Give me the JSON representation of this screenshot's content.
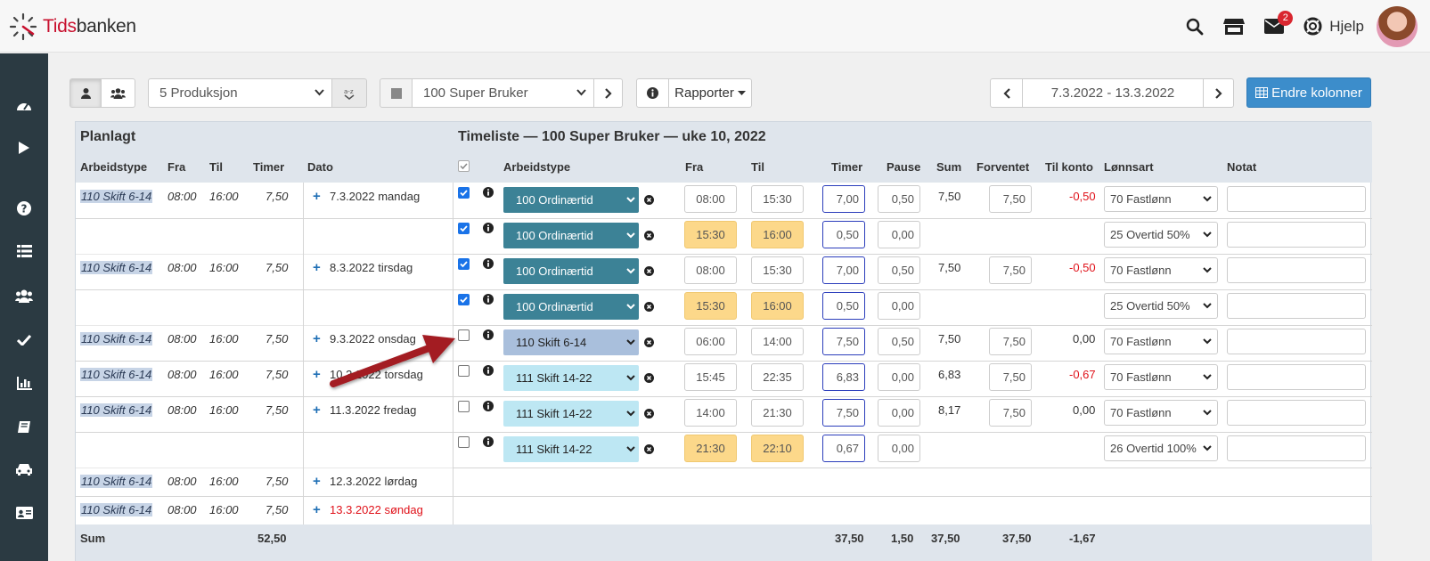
{
  "header": {
    "logo_red": "Tids",
    "logo_dark": "banken",
    "help_label": "Hjelp",
    "mail_badge": "2"
  },
  "sidebar_icons": [
    "dashboard-icon",
    "play-icon",
    "question-icon",
    "list-icon",
    "users-icon",
    "check-icon",
    "chart-icon",
    "book-icon",
    "car-icon",
    "id-card-icon"
  ],
  "toolbar": {
    "department": "5 Produksjon",
    "employee": "100 Super Bruker",
    "reports": "Rapporter",
    "date_range": "7.3.2022 - 13.3.2022",
    "change_columns": "Endre kolonner"
  },
  "table": {
    "left_title": "Planlagt",
    "right_title": "Timeliste — 100 Super Bruker — uke 10, 2022",
    "left_headers": {
      "arbeidstype": "Arbeidstype",
      "fra": "Fra",
      "til": "Til",
      "timer": "Timer",
      "dato": "Dato"
    },
    "right_headers": {
      "arbeidstype": "Arbeidstype",
      "fra": "Fra",
      "til": "Til",
      "timer": "Timer",
      "pause": "Pause",
      "sum": "Sum",
      "forventet": "Forventet",
      "til_konto": "Til konto",
      "lonnsart": "Lønnsart",
      "notat": "Notat"
    },
    "planned": [
      {
        "type": "110 Skift 6-14",
        "fra": "08:00",
        "til": "16:00",
        "timer": "7,50",
        "dato": "7.3.2022 mandag"
      },
      {
        "type": "110 Skift 6-14",
        "fra": "08:00",
        "til": "16:00",
        "timer": "7,50",
        "dato": "8.3.2022 tirsdag"
      },
      {
        "type": "110 Skift 6-14",
        "fra": "08:00",
        "til": "16:00",
        "timer": "7,50",
        "dato": "9.3.2022 onsdag"
      },
      {
        "type": "110 Skift 6-14",
        "fra": "08:00",
        "til": "16:00",
        "timer": "7,50",
        "dato": "10.3.2022 torsdag"
      },
      {
        "type": "110 Skift 6-14",
        "fra": "08:00",
        "til": "16:00",
        "timer": "7,50",
        "dato": "11.3.2022 fredag"
      },
      {
        "type": "110 Skift 6-14",
        "fra": "08:00",
        "til": "16:00",
        "timer": "7,50",
        "dato": "12.3.2022 lørdag"
      },
      {
        "type": "110 Skift 6-14",
        "fra": "08:00",
        "til": "16:00",
        "timer": "7,50",
        "dato": "13.3.2022 søndag"
      }
    ],
    "entries": [
      {
        "checked": true,
        "type": "100 Ordinærtid",
        "style": "dark",
        "fra": "08:00",
        "til": "15:30",
        "yellow": false,
        "timer": "7,00",
        "pause": "0,50",
        "sum": "7,50",
        "forventet": "7,50",
        "til_konto": "-0,50",
        "konto_red": true,
        "lonnsart": "70 Fastlønn"
      },
      {
        "checked": true,
        "type": "100 Ordinærtid",
        "style": "dark",
        "fra": "15:30",
        "til": "16:00",
        "yellow": true,
        "timer": "0,50",
        "pause": "0,00",
        "sum": "",
        "forventet": "",
        "til_konto": "",
        "konto_red": false,
        "lonnsart": "25 Overtid 50%"
      },
      {
        "checked": true,
        "type": "100 Ordinærtid",
        "style": "dark",
        "fra": "08:00",
        "til": "15:30",
        "yellow": false,
        "timer": "7,00",
        "pause": "0,50",
        "sum": "7,50",
        "forventet": "7,50",
        "til_konto": "-0,50",
        "konto_red": true,
        "lonnsart": "70 Fastlønn"
      },
      {
        "checked": true,
        "type": "100 Ordinærtid",
        "style": "dark",
        "fra": "15:30",
        "til": "16:00",
        "yellow": true,
        "timer": "0,50",
        "pause": "0,00",
        "sum": "",
        "forventet": "",
        "til_konto": "",
        "konto_red": false,
        "lonnsart": "25 Overtid 50%"
      },
      {
        "checked": false,
        "type": "110 Skift 6-14",
        "style": "grey",
        "fra": "06:00",
        "til": "14:00",
        "yellow": false,
        "timer": "7,50",
        "pause": "0,50",
        "sum": "7,50",
        "forventet": "7,50",
        "til_konto": "0,00",
        "konto_red": false,
        "lonnsart": "70 Fastlønn"
      },
      {
        "checked": false,
        "type": "111 Skift 14-22",
        "style": "light",
        "fra": "15:45",
        "til": "22:35",
        "yellow": false,
        "timer": "6,83",
        "pause": "0,00",
        "sum": "6,83",
        "forventet": "7,50",
        "til_konto": "-0,67",
        "konto_red": true,
        "lonnsart": "70 Fastlønn"
      },
      {
        "checked": false,
        "type": "111 Skift 14-22",
        "style": "light",
        "fra": "14:00",
        "til": "21:30",
        "yellow": false,
        "timer": "7,50",
        "pause": "0,00",
        "sum": "8,17",
        "forventet": "7,50",
        "til_konto": "0,00",
        "konto_red": false,
        "lonnsart": "70 Fastlønn"
      },
      {
        "checked": false,
        "type": "111 Skift 14-22",
        "style": "light",
        "fra": "21:30",
        "til": "22:10",
        "yellow": true,
        "timer": "0,67",
        "pause": "0,00",
        "sum": "",
        "forventet": "",
        "til_konto": "",
        "konto_red": false,
        "lonnsart": "26 Overtid 100%"
      }
    ],
    "footer": {
      "label": "Sum",
      "planned_timer": "52,50",
      "timer": "37,50",
      "pause": "1,50",
      "sum": "37,50",
      "forventet": "37,50",
      "til_konto": "-1,67"
    }
  }
}
